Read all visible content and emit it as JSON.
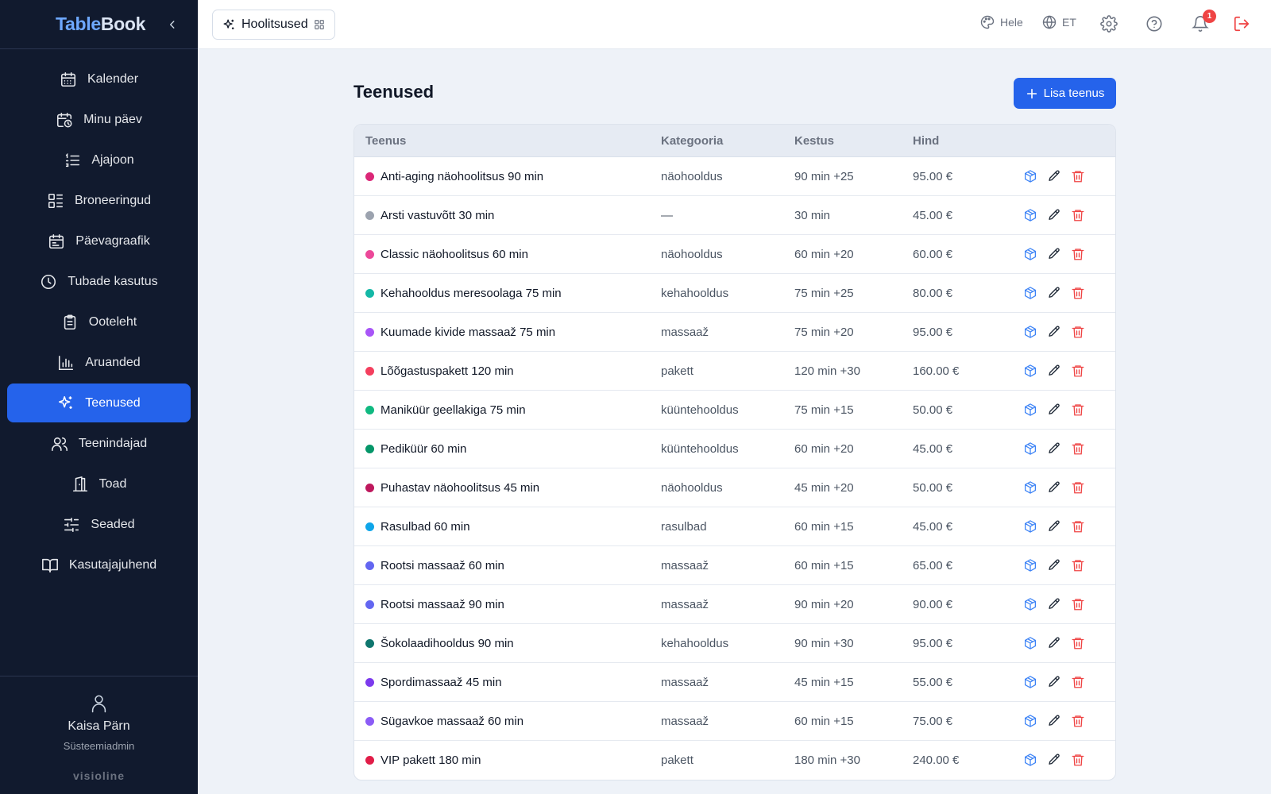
{
  "app": {
    "logo_part1": "Table",
    "logo_part2": "Book"
  },
  "sidebar": {
    "items": [
      {
        "label": "Kalender",
        "icon": "calendar-icon"
      },
      {
        "label": "Minu päev",
        "icon": "calendar-clock-icon"
      },
      {
        "label": "Ajajoon",
        "icon": "list-ordered-icon"
      },
      {
        "label": "Broneeringud",
        "icon": "list-grid-icon"
      },
      {
        "label": "Päevagraafik",
        "icon": "calendar-days-icon"
      },
      {
        "label": "Tubade kasutus",
        "icon": "clock-icon"
      },
      {
        "label": "Ooteleht",
        "icon": "clipboard-icon"
      },
      {
        "label": "Aruanded",
        "icon": "bar-chart-icon"
      },
      {
        "label": "Teenused",
        "icon": "sparkles-icon",
        "active": true
      },
      {
        "label": "Teenindajad",
        "icon": "users-icon"
      },
      {
        "label": "Toad",
        "icon": "door-icon"
      },
      {
        "label": "Seaded",
        "icon": "sliders-icon"
      },
      {
        "label": "Kasutajajuhend",
        "icon": "book-icon"
      }
    ],
    "user": {
      "name": "Kaisa Pärn",
      "role": "Süsteemiadmin"
    },
    "footer_brand": "visioline"
  },
  "topbar": {
    "module": "Hoolitsused",
    "theme": "Hele",
    "language": "ET",
    "notifications_count": "1"
  },
  "page": {
    "title": "Teenused",
    "add_button": "Lisa teenus"
  },
  "table": {
    "headers": {
      "name": "Teenus",
      "category": "Kategooria",
      "duration": "Kestus",
      "price": "Hind"
    },
    "rows": [
      {
        "color": "#db2777",
        "name": "Anti-aging näohoolitsus 90 min",
        "category": "näohooldus",
        "duration": "90 min +25",
        "price": "95.00 €"
      },
      {
        "color": "#9ca3af",
        "name": "Arsti vastuvõtt 30 min",
        "category": "—",
        "duration": "30 min",
        "price": "45.00 €"
      },
      {
        "color": "#ec4899",
        "name": "Classic näohoolitsus 60 min",
        "category": "näohooldus",
        "duration": "60 min +20",
        "price": "60.00 €"
      },
      {
        "color": "#14b8a6",
        "name": "Kehahooldus meresoolaga 75 min",
        "category": "kehahooldus",
        "duration": "75 min +25",
        "price": "80.00 €"
      },
      {
        "color": "#a855f7",
        "name": "Kuumade kivide massaaž 75 min",
        "category": "massaaž",
        "duration": "75 min +20",
        "price": "95.00 €"
      },
      {
        "color": "#f43f5e",
        "name": "Lõõgastuspakett 120 min",
        "category": "pakett",
        "duration": "120 min +30",
        "price": "160.00 €"
      },
      {
        "color": "#10b981",
        "name": "Maniküür geellakiga 75 min",
        "category": "küüntehooldus",
        "duration": "75 min +15",
        "price": "50.00 €"
      },
      {
        "color": "#059669",
        "name": "Pediküür 60 min",
        "category": "küüntehooldus",
        "duration": "60 min +20",
        "price": "45.00 €"
      },
      {
        "color": "#be185d",
        "name": "Puhastav näohoolitsus 45 min",
        "category": "näohooldus",
        "duration": "45 min +20",
        "price": "50.00 €"
      },
      {
        "color": "#0ea5e9",
        "name": "Rasulbad 60 min",
        "category": "rasulbad",
        "duration": "60 min +15",
        "price": "45.00 €"
      },
      {
        "color": "#6366f1",
        "name": "Rootsi massaaž 60 min",
        "category": "massaaž",
        "duration": "60 min +15",
        "price": "65.00 €"
      },
      {
        "color": "#6366f1",
        "name": "Rootsi massaaž 90 min",
        "category": "massaaž",
        "duration": "90 min +20",
        "price": "90.00 €"
      },
      {
        "color": "#0f766e",
        "name": "Šokolaadihooldus 90 min",
        "category": "kehahooldus",
        "duration": "90 min +30",
        "price": "95.00 €"
      },
      {
        "color": "#7c3aed",
        "name": "Spordimassaaž 45 min",
        "category": "massaaž",
        "duration": "45 min +15",
        "price": "55.00 €"
      },
      {
        "color": "#8b5cf6",
        "name": "Sügavkoe massaaž 60 min",
        "category": "massaaž",
        "duration": "60 min +15",
        "price": "75.00 €"
      },
      {
        "color": "#e11d48",
        "name": "VIP pakett 180 min",
        "category": "pakett",
        "duration": "180 min +30",
        "price": "240.00 €"
      }
    ],
    "row_actions": [
      "package-icon",
      "edit-icon",
      "delete-icon"
    ]
  },
  "colors": {
    "accent": "#2563eb",
    "sidebar_bg": "#111a2e",
    "danger": "#ef4444",
    "package_blue": "#3b82f6"
  }
}
